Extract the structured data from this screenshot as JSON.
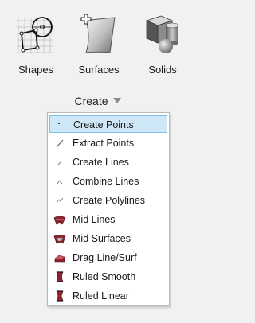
{
  "toolbar": {
    "tools": [
      {
        "label": "Shapes",
        "icon": "shapes-icon"
      },
      {
        "label": "Surfaces",
        "icon": "surfaces-icon"
      },
      {
        "label": "Solids",
        "icon": "solids-icon"
      }
    ],
    "group_label": "Create"
  },
  "menu": {
    "items": [
      {
        "label": "Create Points",
        "icon": "point-icon",
        "active": true
      },
      {
        "label": "Extract Points",
        "icon": "extract-points-icon"
      },
      {
        "label": "Create Lines",
        "icon": "line-icon"
      },
      {
        "label": "Combine Lines",
        "icon": "combine-lines-icon"
      },
      {
        "label": "Create Polylines",
        "icon": "polyline-icon"
      },
      {
        "label": "Mid Lines",
        "icon": "mid-lines-icon"
      },
      {
        "label": "Mid Surfaces",
        "icon": "mid-surfaces-icon"
      },
      {
        "label": "Drag Line/Surf",
        "icon": "drag-line-surf-icon"
      },
      {
        "label": "Ruled Smooth",
        "icon": "ruled-smooth-icon"
      },
      {
        "label": "Ruled Linear",
        "icon": "ruled-linear-icon"
      }
    ]
  },
  "colors": {
    "background": "#f1f1f1",
    "menu_highlight": "#cfe8f7",
    "menu_highlight_border": "#7cc0e8",
    "solid_icon_gray": "#7a7a7a",
    "surface_icon_red": "#8f2430"
  }
}
